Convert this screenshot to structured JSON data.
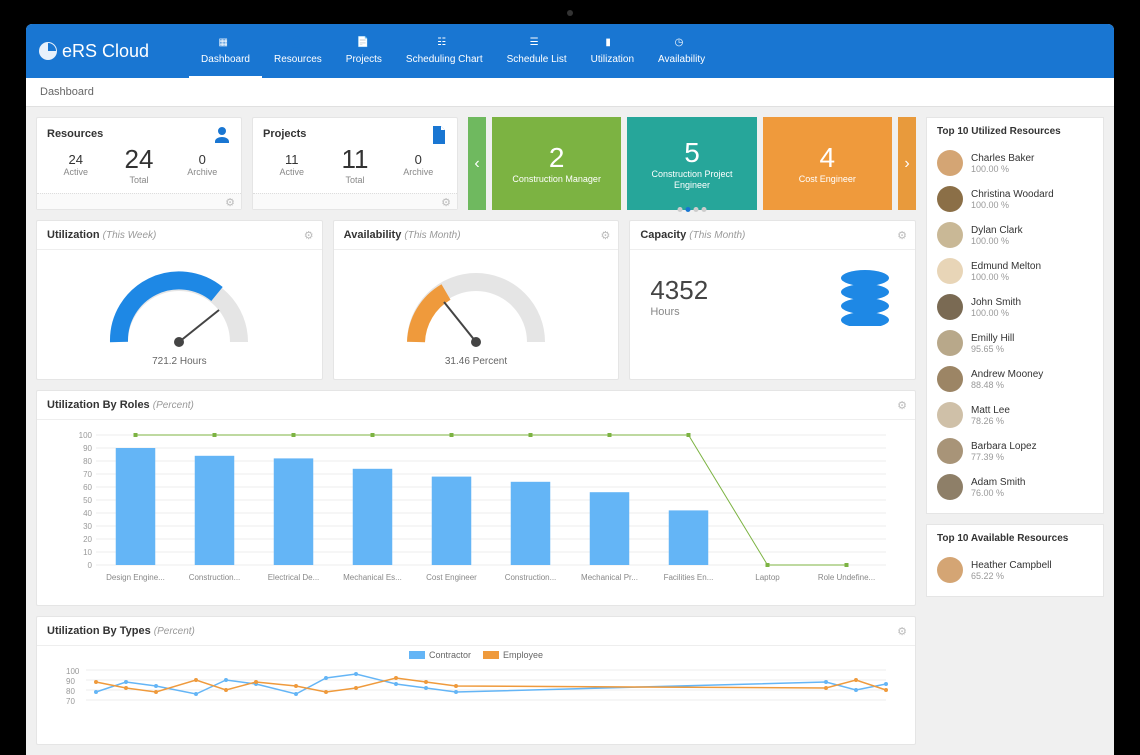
{
  "app_name": "eRS Cloud",
  "nav": [
    {
      "label": "Dashboard",
      "active": true
    },
    {
      "label": "Resources"
    },
    {
      "label": "Projects"
    },
    {
      "label": "Scheduling Chart"
    },
    {
      "label": "Schedule List"
    },
    {
      "label": "Utilization"
    },
    {
      "label": "Availability"
    }
  ],
  "breadcrumb": "Dashboard",
  "stats": {
    "resources": {
      "title": "Resources",
      "total": "24",
      "total_label": "Total",
      "active": "24",
      "active_label": "Active",
      "archive": "0",
      "archive_label": "Archive"
    },
    "projects": {
      "title": "Projects",
      "total": "11",
      "total_label": "Total",
      "active": "11",
      "active_label": "Active",
      "archive": "0",
      "archive_label": "Archive"
    }
  },
  "carousel": [
    {
      "count": "2",
      "label": "Construction Manager",
      "color": "#7cb342"
    },
    {
      "count": "5",
      "label": "Construction Project Engineer",
      "color": "#26a69a"
    },
    {
      "count": "4",
      "label": "Cost Engineer",
      "color": "#ef9a3c"
    }
  ],
  "gauges": {
    "utilization": {
      "title": "Utilization",
      "period": "(This Week)",
      "value": "721.2 Hours"
    },
    "availability": {
      "title": "Availability",
      "period": "(This Month)",
      "value": "31.46 Percent"
    },
    "capacity": {
      "title": "Capacity",
      "period": "(This Month)",
      "value": "4352",
      "unit": "Hours"
    }
  },
  "chart_roles": {
    "title": "Utilization By Roles",
    "unit": "(Percent)"
  },
  "chart_types": {
    "title": "Utilization By Types",
    "unit": "(Percent)",
    "legend": [
      "Contractor",
      "Employee"
    ]
  },
  "top_utilized": {
    "title": "Top 10 Utilized Resources",
    "items": [
      {
        "name": "Charles Baker",
        "pct": "100.00 %"
      },
      {
        "name": "Christina Woodard",
        "pct": "100.00 %"
      },
      {
        "name": "Dylan Clark",
        "pct": "100.00 %"
      },
      {
        "name": "Edmund Melton",
        "pct": "100.00 %"
      },
      {
        "name": "John Smith",
        "pct": "100.00 %"
      },
      {
        "name": "Emilly Hill",
        "pct": "95.65 %"
      },
      {
        "name": "Andrew Mooney",
        "pct": "88.48 %"
      },
      {
        "name": "Matt Lee",
        "pct": "78.26 %"
      },
      {
        "name": "Barbara Lopez",
        "pct": "77.39 %"
      },
      {
        "name": "Adam Smith",
        "pct": "76.00 %"
      }
    ]
  },
  "top_available": {
    "title": "Top 10 Available Resources",
    "items": [
      {
        "name": "Heather Campbell",
        "pct": "65.22 %"
      }
    ]
  },
  "chart_data": [
    {
      "type": "bar",
      "title": "Utilization By Roles (Percent)",
      "categories": [
        "Design Engine...",
        "Construction...",
        "Electrical De...",
        "Mechanical Es...",
        "Cost Engineer",
        "Construction...",
        "Mechanical Pr...",
        "Facilities En...",
        "Laptop",
        "Role Undefine..."
      ],
      "series": [
        {
          "name": "Bar",
          "values": [
            90,
            84,
            82,
            74,
            68,
            64,
            56,
            42,
            0,
            0
          ]
        },
        {
          "name": "Line",
          "values": [
            100,
            100,
            100,
            100,
            100,
            100,
            100,
            100,
            0,
            0
          ]
        }
      ],
      "ylabel": "",
      "xlabel": "",
      "ylim": [
        0,
        100
      ],
      "yticks": [
        0,
        10,
        20,
        30,
        40,
        50,
        60,
        70,
        80,
        90,
        100
      ]
    },
    {
      "type": "line",
      "title": "Utilization By Types (Percent)",
      "series": [
        {
          "name": "Contractor",
          "color": "#64b5f6"
        },
        {
          "name": "Employee",
          "color": "#ef9a3c"
        }
      ],
      "ylim": [
        0,
        100
      ],
      "yticks": [
        70,
        80,
        90,
        100
      ]
    }
  ],
  "avatar_colors": [
    "#d4a574",
    "#8b6f47",
    "#c9b896",
    "#e8d5b7",
    "#7a6a53",
    "#b8a88a",
    "#9c8565",
    "#cfc0a8",
    "#a89478",
    "#8e7f68",
    "#bfae91"
  ]
}
